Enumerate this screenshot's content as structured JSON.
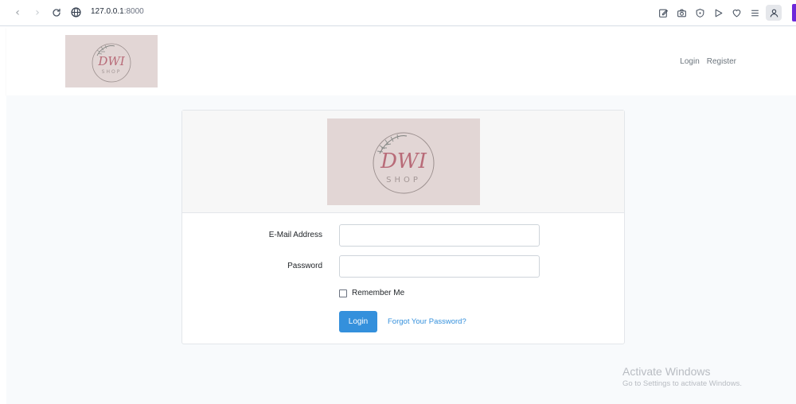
{
  "browser": {
    "url_host": "127.0.0.1",
    "url_port": ":8000",
    "back_icon": "chevron-left-icon",
    "forward_icon": "chevron-right-icon",
    "reload_icon": "reload-icon",
    "site_icon": "globe-icon",
    "toolbar_icons": [
      "edit-icon",
      "camera-icon",
      "shield-icon",
      "play-icon",
      "heart-icon",
      "menu-icon",
      "profile-icon"
    ]
  },
  "navbar": {
    "logo": {
      "script_text": "DWI",
      "sub_text": "SHOP"
    },
    "links": {
      "login": "Login",
      "register": "Register"
    }
  },
  "card": {
    "logo": {
      "script_text": "DWI",
      "sub_text": "SHOP"
    },
    "email": {
      "label": "E-Mail Address",
      "value": "",
      "placeholder": ""
    },
    "password": {
      "label": "Password",
      "value": "",
      "placeholder": ""
    },
    "remember": {
      "label": "Remember Me",
      "checked": false
    },
    "login_button": "Login",
    "forgot_link": "Forgot Your Password?"
  },
  "watermark": {
    "title": "Activate Windows",
    "subtitle": "Go to Settings to activate Windows."
  },
  "colors": {
    "primary": "#3490dc",
    "logo_background": "#e2d6d5",
    "page_background": "#f8fafc",
    "extension_accent": "#6d28d9"
  }
}
